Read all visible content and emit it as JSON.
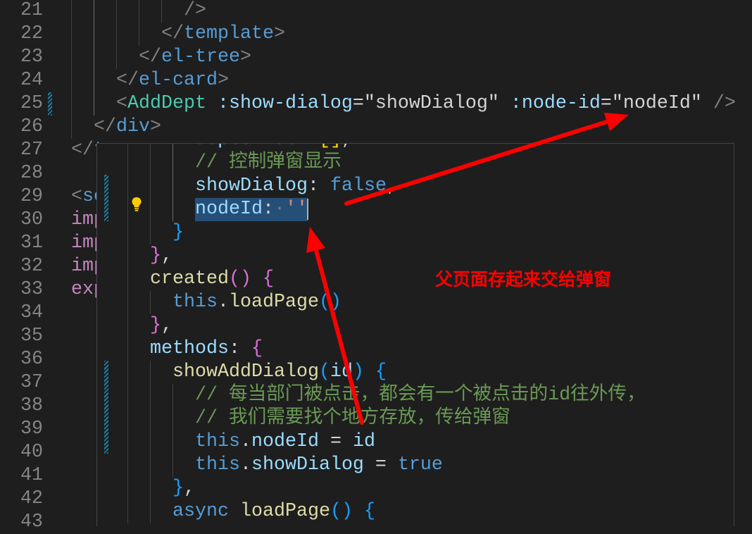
{
  "main": {
    "lines": [
      {
        "n": "21",
        "tokens": [
          {
            "t": "          />",
            "color": "#808080"
          }
        ]
      },
      {
        "n": "22",
        "tokens": [
          {
            "t": "        </",
            "color": "#808080"
          },
          {
            "t": "template",
            "color": "#569cd6"
          },
          {
            "t": ">",
            "color": "#808080"
          }
        ]
      },
      {
        "n": "23",
        "tokens": [
          {
            "t": "      </",
            "color": "#808080"
          },
          {
            "t": "el-tree",
            "color": "#569cd6"
          },
          {
            "t": ">",
            "color": "#808080"
          }
        ]
      },
      {
        "n": "24",
        "tokens": [
          {
            "t": "    </",
            "color": "#808080"
          },
          {
            "t": "el-card",
            "color": "#569cd6"
          },
          {
            "t": ">",
            "color": "#808080"
          }
        ]
      },
      {
        "n": "25",
        "tokens": [
          {
            "t": "    <",
            "color": "#808080"
          },
          {
            "t": "AddDept",
            "color": "#4ec9b0"
          },
          {
            "t": " :show-dialog",
            "color": "#9cdcfe"
          },
          {
            "t": "=",
            "color": "#d4d4d4"
          },
          {
            "t": "\"showDialog\"",
            "color": "#d4d4d4"
          },
          {
            "t": " :node-id",
            "color": "#9cdcfe"
          },
          {
            "t": "=",
            "color": "#d4d4d4"
          },
          {
            "t": "\"nodeId\"",
            "color": "#d4d4d4"
          },
          {
            "t": " />",
            "color": "#808080"
          }
        ]
      },
      {
        "n": "26",
        "tokens": [
          {
            "t": "  </",
            "color": "#808080"
          },
          {
            "t": "div",
            "color": "#569cd6"
          },
          {
            "t": ">",
            "color": "#808080"
          }
        ]
      },
      {
        "n": "27",
        "tokens": [
          {
            "t": "</",
            "color": "#808080"
          },
          {
            "t": "t",
            "color": "#569cd6"
          }
        ]
      },
      {
        "n": "28",
        "tokens": []
      },
      {
        "n": "29",
        "tokens": [
          {
            "t": "<",
            "color": "#808080"
          },
          {
            "t": "sc",
            "color": "#569cd6"
          }
        ]
      },
      {
        "n": "30",
        "tokens": [
          {
            "t": "imp",
            "color": "#c586c0"
          }
        ]
      },
      {
        "n": "31",
        "tokens": [
          {
            "t": "imp",
            "color": "#c586c0"
          }
        ]
      },
      {
        "n": "32",
        "tokens": [
          {
            "t": "imp",
            "color": "#c586c0"
          }
        ]
      },
      {
        "n": "33",
        "tokens": [
          {
            "t": "exp",
            "color": "#c586c0"
          }
        ]
      },
      {
        "n": "34",
        "tokens": []
      },
      {
        "n": "35",
        "tokens": []
      },
      {
        "n": "36",
        "tokens": []
      },
      {
        "n": "37",
        "tokens": []
      },
      {
        "n": "38",
        "tokens": []
      },
      {
        "n": "39",
        "tokens": []
      },
      {
        "n": "40",
        "tokens": []
      },
      {
        "n": "41",
        "tokens": []
      },
      {
        "n": "42",
        "tokens": []
      },
      {
        "n": "43",
        "tokens": []
      }
    ]
  },
  "hover": {
    "lines": [
      {
        "tokens": [
          {
            "t": "      deptsList",
            "color": "#9cdcfe"
          },
          {
            "t": ": ",
            "color": "#d4d4d4"
          },
          {
            "t": "[]",
            "color": "#ffd700"
          },
          {
            "t": ",",
            "color": "#d4d4d4"
          }
        ]
      },
      {
        "tokens": [
          {
            "t": "      // 控制弹窗显示",
            "color": "#6a9955"
          }
        ]
      },
      {
        "tokens": [
          {
            "t": "      showDialog",
            "color": "#9cdcfe"
          },
          {
            "t": ": ",
            "color": "#d4d4d4"
          },
          {
            "t": "false",
            "color": "#569cd6"
          },
          {
            "t": ",",
            "color": "#d4d4d4"
          }
        ]
      },
      {
        "tokens": [
          {
            "t": "      nodeId",
            "color": "#9cdcfe"
          },
          {
            "t": ":",
            "color": "#d4d4d4"
          },
          {
            "t": "·",
            "color": "#7a7a7a"
          },
          {
            "t": "''",
            "color": "#ce9178"
          }
        ]
      },
      {
        "tokens": [
          {
            "t": "    }",
            "color": "#179fff"
          }
        ]
      },
      {
        "tokens": [
          {
            "t": "  }",
            "color": "#da70d6"
          },
          {
            "t": ",",
            "color": "#d4d4d4"
          }
        ]
      },
      {
        "tokens": [
          {
            "t": "  created",
            "color": "#dcdcaa"
          },
          {
            "t": "()",
            "color": "#da70d6"
          },
          {
            "t": " ",
            "color": "#d4d4d4"
          },
          {
            "t": "{",
            "color": "#da70d6"
          }
        ]
      },
      {
        "tokens": [
          {
            "t": "    this",
            "color": "#569cd6"
          },
          {
            "t": ".",
            "color": "#d4d4d4"
          },
          {
            "t": "loadPage",
            "color": "#dcdcaa"
          },
          {
            "t": "()",
            "color": "#179fff"
          }
        ]
      },
      {
        "tokens": [
          {
            "t": "  }",
            "color": "#da70d6"
          },
          {
            "t": ",",
            "color": "#d4d4d4"
          }
        ]
      },
      {
        "tokens": [
          {
            "t": "  methods",
            "color": "#9cdcfe"
          },
          {
            "t": ": ",
            "color": "#d4d4d4"
          },
          {
            "t": "{",
            "color": "#da70d6"
          }
        ]
      },
      {
        "tokens": [
          {
            "t": "    showAddDialog",
            "color": "#dcdcaa"
          },
          {
            "t": "(",
            "color": "#179fff"
          },
          {
            "t": "id",
            "color": "#9cdcfe"
          },
          {
            "t": ")",
            "color": "#179fff"
          },
          {
            "t": " ",
            "color": "#d4d4d4"
          },
          {
            "t": "{",
            "color": "#179fff"
          }
        ]
      },
      {
        "tokens": [
          {
            "t": "      // 每当部门被点击，都会有一个被点击的id往外传，",
            "color": "#6a9955"
          }
        ]
      },
      {
        "tokens": [
          {
            "t": "      // 我们需要找个地方存放，传给弹窗",
            "color": "#6a9955"
          }
        ]
      },
      {
        "tokens": [
          {
            "t": "      this",
            "color": "#569cd6"
          },
          {
            "t": ".",
            "color": "#d4d4d4"
          },
          {
            "t": "nodeId",
            "color": "#9cdcfe"
          },
          {
            "t": " = ",
            "color": "#d4d4d4"
          },
          {
            "t": "id",
            "color": "#9cdcfe"
          }
        ]
      },
      {
        "tokens": [
          {
            "t": "      this",
            "color": "#569cd6"
          },
          {
            "t": ".",
            "color": "#d4d4d4"
          },
          {
            "t": "showDialog",
            "color": "#9cdcfe"
          },
          {
            "t": " = ",
            "color": "#d4d4d4"
          },
          {
            "t": "true",
            "color": "#569cd6"
          }
        ]
      },
      {
        "tokens": [
          {
            "t": "    }",
            "color": "#179fff"
          },
          {
            "t": ",",
            "color": "#d4d4d4"
          }
        ]
      },
      {
        "tokens": [
          {
            "t": "    async",
            "color": "#569cd6"
          },
          {
            "t": " ",
            "color": "#d4d4d4"
          },
          {
            "t": "loadPage",
            "color": "#dcdcaa"
          },
          {
            "t": "()",
            "color": "#179fff"
          },
          {
            "t": " ",
            "color": "#d4d4d4"
          },
          {
            "t": "{",
            "color": "#179fff"
          }
        ]
      }
    ],
    "lightbulb_icon": "lightbulb-icon"
  },
  "annotation": {
    "text": "父页面存起来交给弹窗",
    "color": "#ff0000"
  },
  "colors": {
    "editor_background": "#1e1e1e",
    "selection": "#264f78",
    "arrow": "#ff0000"
  }
}
